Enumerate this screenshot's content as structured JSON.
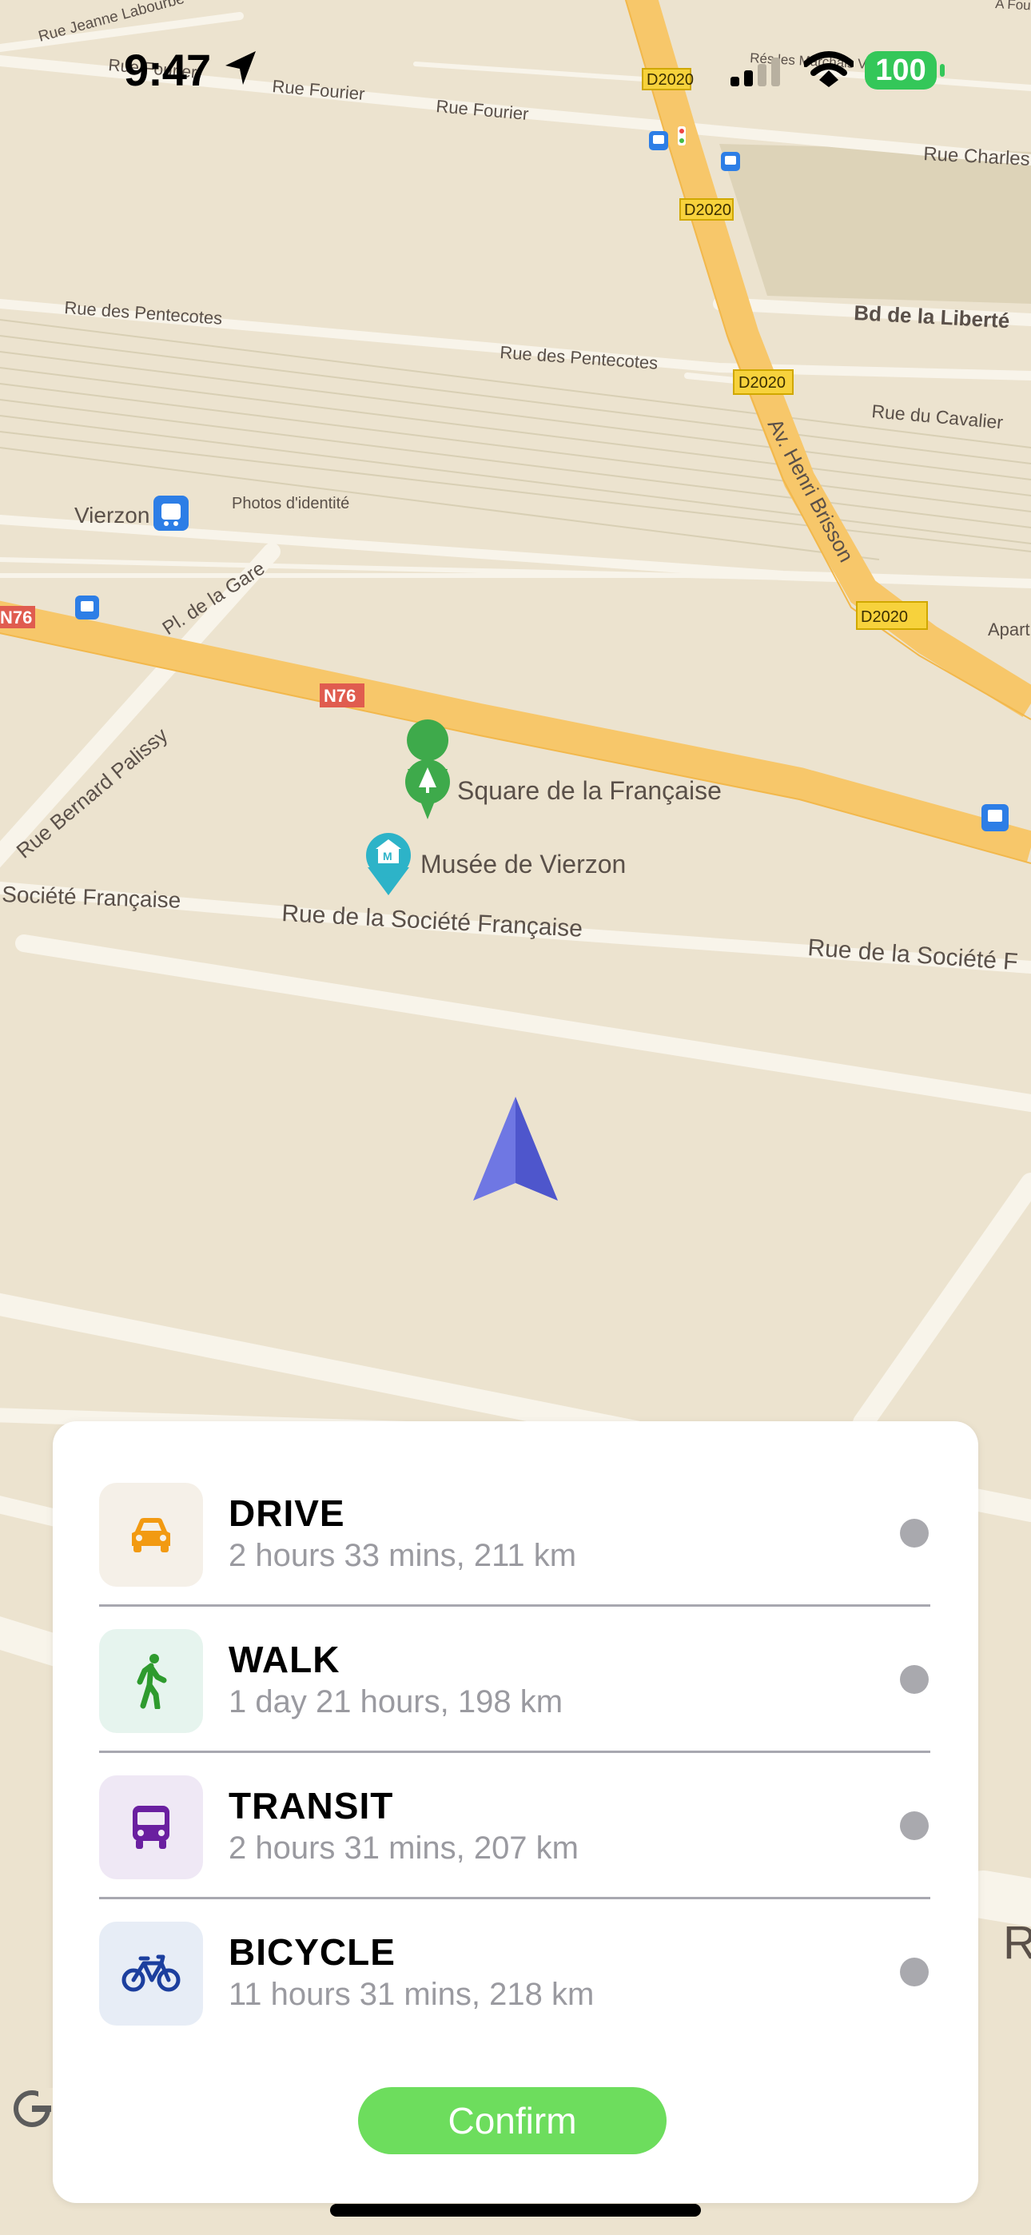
{
  "status_bar": {
    "time": "9:47",
    "battery": "100",
    "icons": [
      "location-arrow-icon",
      "cellular-signal-icon",
      "wifi-icon",
      "battery-icon"
    ]
  },
  "map": {
    "streets": {
      "rue_jeanne_labourbe": "Rue Jeanne Labourbe",
      "rue_fourier_1": "Rue Fourier",
      "rue_fourier_2": "Rue Fourier",
      "rue_fourier_3": "Rue Fourier",
      "rue_charles": "Rue Charles H",
      "bd_liberte": "Bd de la Liberté",
      "rue_pentecotes_1": "Rue des Pentecotes",
      "rue_pentecotes_2": "Rue des Pentecotes",
      "rue_cavalier": "Rue du Cavalier",
      "av_henri_brisson": "Av. Henri Brisson",
      "pl_gare": "Pl. de la Gare",
      "rue_bernard_palissy": "Rue Bernard Palissy",
      "societe_francaise": "Société Française",
      "rue_societe_francaise": "Rue de la Société Française",
      "rue_societe_f": "Rue de la Société F",
      "apart": "Apart",
      "res_marchais": "Rés les Marchais Ver",
      "a_fouc": "A Fouc",
      "big_r": "R"
    },
    "road_signs": {
      "d2020_1": "D2020",
      "d2020_2": "D2020",
      "d2020_3": "D2020",
      "d2020_4": "D2020",
      "n76_1": "N76",
      "n76_2": "N76"
    },
    "places": {
      "vierzon": "Vierzon",
      "photos": "Photos d'identité",
      "square": "Square de la Française",
      "musee": "Musée de Vierzon"
    },
    "colors": {
      "land": "#ece3cf",
      "minor_road": "#f8f4ea",
      "major_road": "#f7c76a",
      "park_pin": "#3eaa4b",
      "museum_pin": "#2db3c8",
      "user_arrow": "#5b63d8"
    }
  },
  "route_options": [
    {
      "mode": "DRIVE",
      "details": "2 hours 33 mins, 211 km",
      "icon": "car-icon",
      "icon_color": "#f29a12",
      "icon_bg": "#f5f0e8"
    },
    {
      "mode": "WALK",
      "details": "1 day 21 hours, 198 km",
      "icon": "walking-person-icon",
      "icon_color": "#2e9b2e",
      "icon_bg": "#e6f4ee"
    },
    {
      "mode": "TRANSIT",
      "details": "2 hours 31 mins, 207 km",
      "icon": "bus-icon",
      "icon_color": "#6a1fa0",
      "icon_bg": "#efe8f5"
    },
    {
      "mode": "BICYCLE",
      "details": "11 hours 31 mins, 218 km",
      "icon": "bicycle-icon",
      "icon_color": "#1c3f9e",
      "icon_bg": "#e7edf6"
    }
  ],
  "confirm_label": "Confirm",
  "confirm_color": "#6ddd5d"
}
